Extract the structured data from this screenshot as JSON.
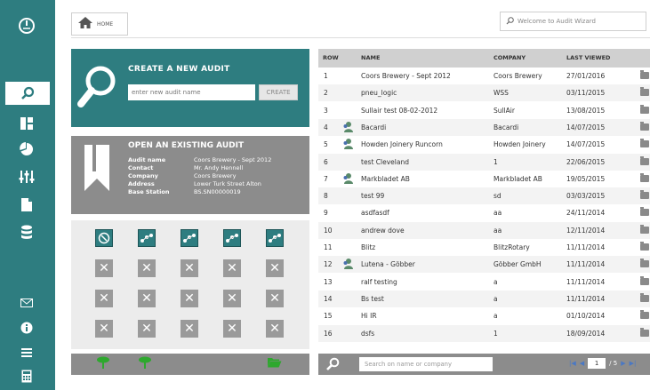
{
  "header": {
    "home_label": "HOME",
    "search_placeholder": "Welcome to Audit Wizard"
  },
  "create": {
    "title": "CREATE A NEW AUDIT",
    "input_placeholder": "enter new audit name",
    "button_label": "CREATE"
  },
  "open": {
    "title": "OPEN AN EXISTING AUDIT",
    "fields": [
      {
        "key": "Audit name",
        "value": "Coors Brewery - Sept 2012"
      },
      {
        "key": "Contact",
        "value": "Mr. Andy Hennell"
      },
      {
        "key": "Company",
        "value": "Coors Brewery"
      },
      {
        "key": "Address",
        "value": "Lower Turk Street Alton"
      },
      {
        "key": "Base Station",
        "value": "BS.SN00000019"
      }
    ]
  },
  "table": {
    "headers": {
      "row": "ROW",
      "name": "NAME",
      "company": "COMPANY",
      "last_viewed": "LAST VIEWED"
    },
    "rows": [
      {
        "row": "1",
        "name": "Coors Brewery - Sept 2012",
        "company": "Coors Brewery",
        "last": "27/01/2016",
        "icon": false
      },
      {
        "row": "2",
        "name": "pneu_logic",
        "company": "WSS",
        "last": "03/11/2015",
        "icon": false
      },
      {
        "row": "3",
        "name": "Sullair test 08-02-2012",
        "company": "SullAir",
        "last": "13/08/2015",
        "icon": false
      },
      {
        "row": "4",
        "name": "Bacardi",
        "company": "Bacardi",
        "last": "14/07/2015",
        "icon": true
      },
      {
        "row": "5",
        "name": "Howden Joinery Runcorn",
        "company": "Howden Joinery",
        "last": "14/07/2015",
        "icon": true
      },
      {
        "row": "6",
        "name": "test Cleveland",
        "company": "1",
        "last": "22/06/2015",
        "icon": false
      },
      {
        "row": "7",
        "name": "Markbladet AB",
        "company": "Markbladet AB",
        "last": "19/05/2015",
        "icon": true
      },
      {
        "row": "8",
        "name": "test 99",
        "company": "sd",
        "last": "03/03/2015",
        "icon": false
      },
      {
        "row": "9",
        "name": "asdfasdf",
        "company": "aa",
        "last": "24/11/2014",
        "icon": false
      },
      {
        "row": "10",
        "name": "andrew dove",
        "company": "aa",
        "last": "12/11/2014",
        "icon": false
      },
      {
        "row": "11",
        "name": "Blitz",
        "company": "BlitzRotary",
        "last": "11/11/2014",
        "icon": false
      },
      {
        "row": "12",
        "name": "Lutena - Göbber",
        "company": "Göbber GmbH",
        "last": "11/11/2014",
        "icon": true
      },
      {
        "row": "13",
        "name": "ralf testing",
        "company": "a",
        "last": "11/11/2014",
        "icon": false
      },
      {
        "row": "14",
        "name": "Bs test",
        "company": "a",
        "last": "11/11/2014",
        "icon": false
      },
      {
        "row": "15",
        "name": "Hi IR",
        "company": "a",
        "last": "01/10/2014",
        "icon": false
      },
      {
        "row": "16",
        "name": "dsfs",
        "company": "1",
        "last": "18/09/2014",
        "icon": false
      }
    ],
    "search_placeholder": "Search on name or company",
    "page_current": "1",
    "page_total": "/ 5"
  },
  "colors": {
    "accent": "#2e7d80",
    "grey_panel": "#8c8c8c"
  }
}
